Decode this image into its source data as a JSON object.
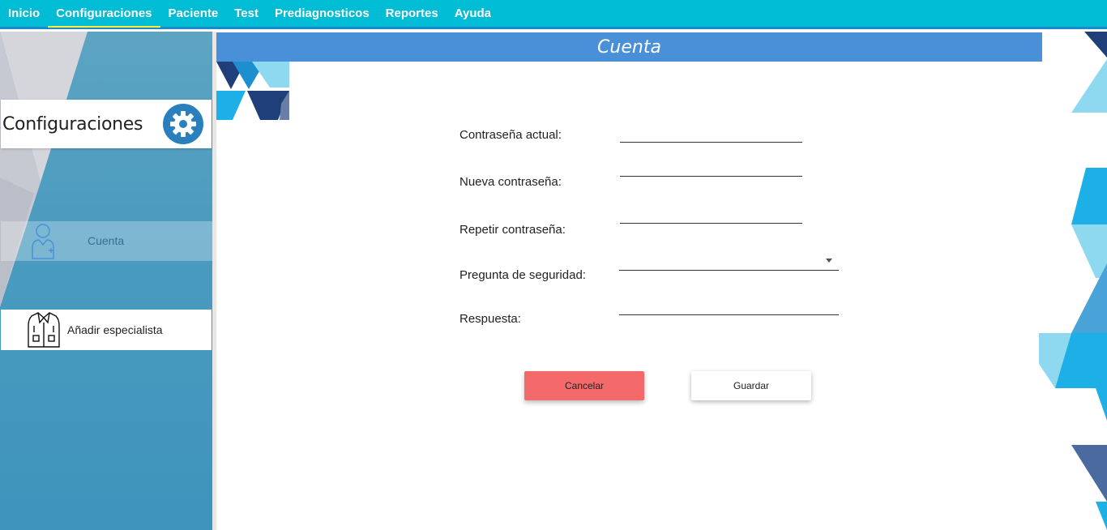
{
  "menu": {
    "items": [
      {
        "label": "Inicio"
      },
      {
        "label": "Configuraciones"
      },
      {
        "label": "Paciente"
      },
      {
        "label": "Test"
      },
      {
        "label": "Prediagnosticos"
      },
      {
        "label": "Reportes"
      },
      {
        "label": "Ayuda"
      }
    ],
    "active": "Configuraciones"
  },
  "sidebar": {
    "section_title": "Configuraciones",
    "section_icon": "gear-icon",
    "items": [
      {
        "label": "Cuenta",
        "icon": "doctor-icon",
        "selected": true
      },
      {
        "label": "Añadir especialista",
        "icon": "lab-coat-icon",
        "selected": false
      }
    ]
  },
  "main": {
    "title": "Cuenta",
    "form": {
      "current_password_label": "Contraseña actual:",
      "current_password_value": "",
      "new_password_label": "Nueva contraseña:",
      "new_password_value": "",
      "repeat_password_label": "Repetir contraseña:",
      "repeat_password_value": "",
      "security_question_label": "Pregunta de seguridad:",
      "security_question_value": "",
      "answer_label": "Respuesta:",
      "answer_value": ""
    },
    "buttons": {
      "cancel_label": "Cancelar",
      "save_label": "Guardar"
    }
  },
  "colors": {
    "menubar": "#00bcd4",
    "header": "#4a90d9",
    "cancel": "#f46a6a",
    "gear_badge": "#2a7fbd"
  }
}
